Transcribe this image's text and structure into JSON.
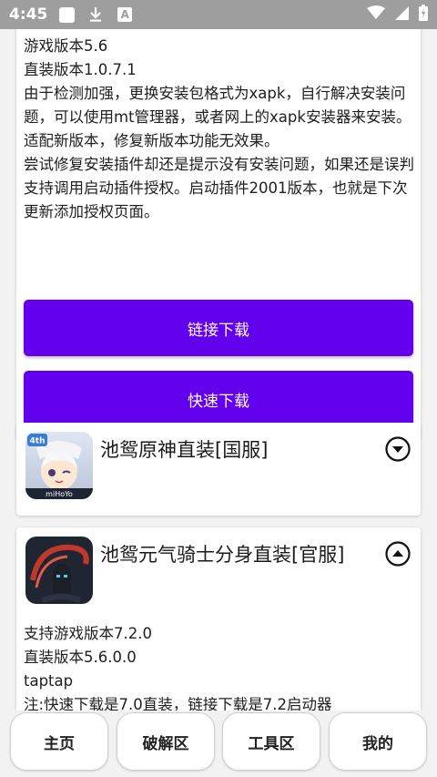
{
  "status_bar": {
    "time": "4:45",
    "icons": [
      "square-notification-icon",
      "download-icon",
      "a-letter-icon",
      "wifi-icon",
      "signal-icon",
      "battery-icon"
    ]
  },
  "card1": {
    "lines": [
      "游戏版本5.6",
      "直装版本1.0.7.1",
      "由于检测加强，更换安装包格式为xapk，自行解决安装问题，可以使用mt管理器，或者网上的xapk安装器来安装。",
      "适配新版本，修复新版本功能无效果。",
      "尝试修复安装插件却还是提示没有安装问题，如果还是误判支持调用启动插件授权。启动插件2001版本，也就是下次更新添加授权页面。"
    ],
    "link_download": "链接下载",
    "fast_download": "快速下载"
  },
  "card2": {
    "title": "池鸳原神直装[国服]",
    "icon_badge": "4th",
    "icon_brand": "miHoYo"
  },
  "card3": {
    "title": "池鸳元气骑士分身直装[官服]",
    "lines": [
      "支持游戏版本7.2.0",
      "直装版本5.6.0.0",
      "taptap",
      "注:快速下载是7.0直装，链接下载是7.2启动器"
    ]
  },
  "nav": {
    "home": "主页",
    "crack": "破解区",
    "tools": "工具区",
    "mine": "我的"
  },
  "colors": {
    "accent": "#6200ee",
    "status_bar": "#9e9e9e"
  }
}
